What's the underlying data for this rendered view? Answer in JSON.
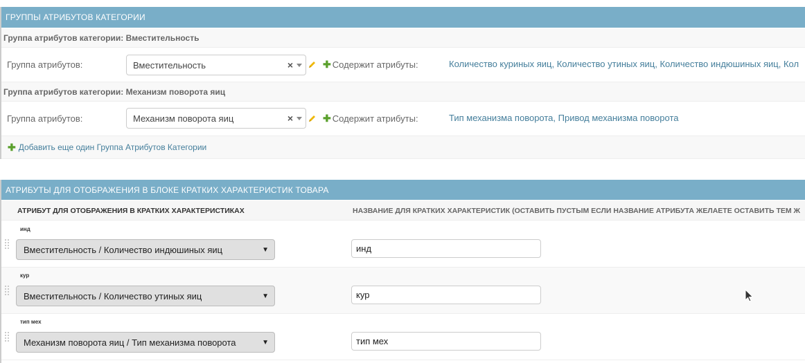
{
  "section1": {
    "header": "Группы атрибутов категории",
    "groups": [
      {
        "title": "Группа атрибутов категории: Вместительность",
        "field_label": "Группа атрибутов:",
        "selected": "Вместительность",
        "clear": "×",
        "contains_label": "Содержит атрибуты:",
        "attributes_text": "Количество куриных яиц, Количество утиных яиц, Количество индюшиных яиц, Кол"
      },
      {
        "title": "Группа атрибутов категории: Механизм поворота яиц",
        "field_label": "Группа атрибутов:",
        "selected": "Механизм поворота яиц",
        "clear": "×",
        "contains_label": "Содержит атрибуты:",
        "attributes_text": "Тип механизма поворота, Привод механизма поворота"
      }
    ],
    "add_label": "Добавить еще один Группа Атрибутов Категории"
  },
  "section2": {
    "header": "Атрибуты для отображения в блоке кратких характеристик товара",
    "col1": "Атрибут для отображения в кратких характеристиках",
    "col2": "Название для кратких характеристик (оставить пустым если название атрибута желаете оставить тем ж",
    "rows": [
      {
        "tag": "инд",
        "select": "Вместительность / Количество индюшиных яиц",
        "input": "инд"
      },
      {
        "tag": "кур",
        "select": "Вместительность / Количество утиных яиц",
        "input": "кур"
      },
      {
        "tag": "тип мех",
        "select": "Механизм поворота яиц / Тип механизма поворота",
        "input": "тип мех"
      }
    ]
  },
  "icons": {
    "pencil": "pencil-icon",
    "plus": "plus-icon",
    "grip": "drag-handle-icon",
    "dropdown": "chevron-down-icon"
  },
  "colors": {
    "header_bg": "#79aec8",
    "link": "#447e9b",
    "add_green": "#5aa02c",
    "pencil": "#efb80b"
  }
}
